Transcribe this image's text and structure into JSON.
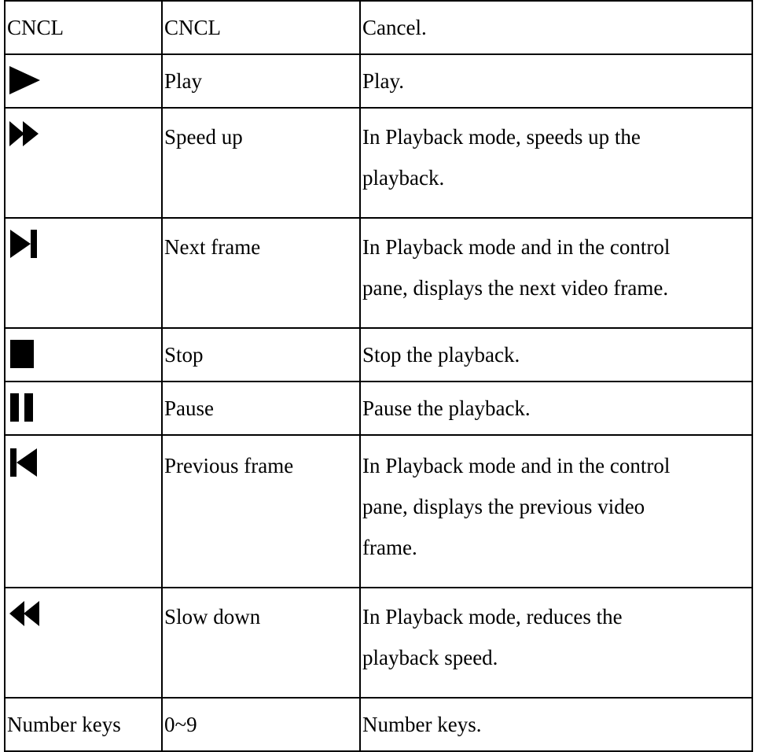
{
  "rows": [
    {
      "key": "CNCL",
      "icon": null,
      "name": "CNCL",
      "desc": [
        "Cancel."
      ]
    },
    {
      "key": "",
      "icon": "play-icon",
      "name": "Play",
      "desc": [
        "Play."
      ]
    },
    {
      "key": "",
      "icon": "fast-forward-icon",
      "name": "Speed up",
      "desc": [
        "In Playback mode, speeds up the",
        "playback."
      ]
    },
    {
      "key": "",
      "icon": "next-frame-icon",
      "name": "Next frame",
      "desc": [
        "In Playback mode and in the control",
        "pane, displays the next video frame."
      ]
    },
    {
      "key": "",
      "icon": "stop-icon",
      "name": "Stop",
      "desc": [
        "Stop the playback."
      ]
    },
    {
      "key": "",
      "icon": "pause-icon",
      "name": "Pause",
      "desc": [
        "Pause the playback."
      ]
    },
    {
      "key": "",
      "icon": "previous-frame-icon",
      "name": "Previous frame",
      "desc": [
        "In Playback mode and in the control",
        "pane, displays the previous video",
        "frame."
      ]
    },
    {
      "key": "",
      "icon": "rewind-icon",
      "name": "Slow down",
      "desc": [
        "In Playback mode, reduces the",
        "playback speed."
      ]
    },
    {
      "key": "Number keys",
      "icon": null,
      "name": "0~9",
      "desc": [
        "Number keys."
      ]
    }
  ]
}
